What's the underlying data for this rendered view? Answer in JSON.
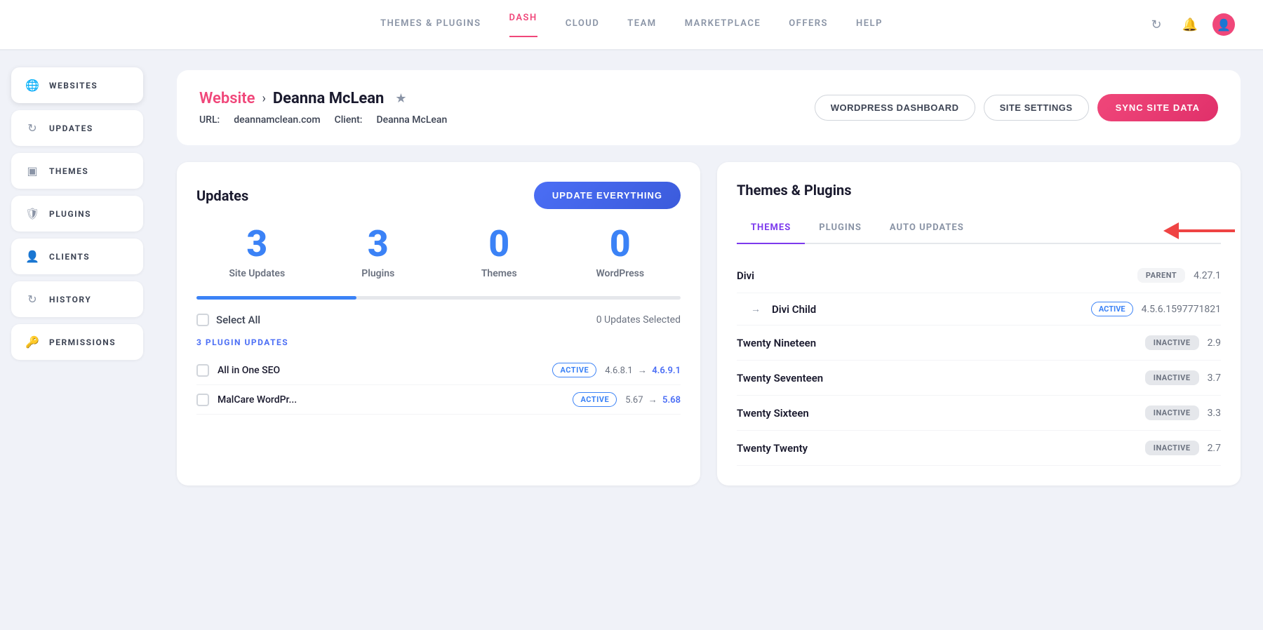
{
  "nav": {
    "links": [
      {
        "id": "themes-plugins",
        "label": "THEMES & PLUGINS",
        "active": false
      },
      {
        "id": "dash",
        "label": "DASH",
        "active": true
      },
      {
        "id": "cloud",
        "label": "CLOUD",
        "active": false
      },
      {
        "id": "team",
        "label": "TEAM",
        "active": false
      },
      {
        "id": "marketplace",
        "label": "MARKETPLACE",
        "active": false
      },
      {
        "id": "offers",
        "label": "OFFERS",
        "active": false
      },
      {
        "id": "help",
        "label": "HELP",
        "active": false
      }
    ]
  },
  "sidebar": {
    "items": [
      {
        "id": "websites",
        "label": "WEBSITES",
        "icon": "🌐",
        "pink": true
      },
      {
        "id": "updates",
        "label": "UPDATES",
        "icon": "🔄",
        "pink": false
      },
      {
        "id": "themes",
        "label": "THEMES",
        "icon": "▣",
        "pink": false
      },
      {
        "id": "plugins",
        "label": "PLUGINS",
        "icon": "🛡",
        "pink": false
      },
      {
        "id": "clients",
        "label": "CLIENTS",
        "icon": "👤",
        "pink": false
      },
      {
        "id": "history",
        "label": "HISTORY",
        "icon": "🔄",
        "pink": false
      },
      {
        "id": "permissions",
        "label": "PERMISSIONS",
        "icon": "🔑",
        "pink": false
      }
    ]
  },
  "page": {
    "breadcrumb_parent": "Website",
    "breadcrumb_arrow": "›",
    "site_name": "Deanna McLean",
    "url_label": "URL:",
    "url_value": "deannamclean.com",
    "client_label": "Client:",
    "client_value": "Deanna McLean",
    "btn_wordpress": "WORDPRESS DASHBOARD",
    "btn_settings": "SITE SETTINGS",
    "btn_sync": "SYNC SITE DATA"
  },
  "updates": {
    "panel_title": "Updates",
    "btn_update": "UPDATE EVERYTHING",
    "stats": [
      {
        "number": "3",
        "label": "Site Updates"
      },
      {
        "number": "3",
        "label": "Plugins"
      },
      {
        "number": "0",
        "label": "Themes"
      },
      {
        "number": "0",
        "label": "WordPress"
      }
    ],
    "select_all": "Select All",
    "updates_count": "0 Updates Selected",
    "plugin_section_label": "3 PLUGIN UPDATES",
    "plugins": [
      {
        "name": "All in One SEO",
        "badge": "ACTIVE",
        "version_from": "4.6.8.1",
        "version_to": "4.6.9.1"
      },
      {
        "name": "MalCare WordPr...",
        "badge": "ACTIVE",
        "version_from": "5.67",
        "version_to": "5.68"
      }
    ]
  },
  "themes_plugins": {
    "panel_title": "Themes & Plugins",
    "tabs": [
      {
        "id": "themes",
        "label": "THEMES",
        "active": true
      },
      {
        "id": "plugins",
        "label": "PLUGINS",
        "active": false
      },
      {
        "id": "auto-updates",
        "label": "AUTO UPDATES",
        "active": false
      }
    ],
    "themes": [
      {
        "name": "Divi",
        "badge": "PARENT",
        "badge_type": "parent",
        "version": "4.27.1",
        "is_child": false
      },
      {
        "name": "Divi Child",
        "badge": "ACTIVE",
        "badge_type": "active",
        "version": "4.5.6.1597771821",
        "is_child": true
      },
      {
        "name": "Twenty Nineteen",
        "badge": "INACTIVE",
        "badge_type": "inactive",
        "version": "2.9",
        "is_child": false
      },
      {
        "name": "Twenty Seventeen",
        "badge": "INACTIVE",
        "badge_type": "inactive",
        "version": "3.7",
        "is_child": false
      },
      {
        "name": "Twenty Sixteen",
        "badge": "INACTIVE",
        "badge_type": "inactive",
        "version": "3.3",
        "is_child": false
      },
      {
        "name": "Twenty Twenty",
        "badge": "INACTIVE",
        "badge_type": "inactive",
        "version": "2.7",
        "is_child": false
      }
    ]
  }
}
